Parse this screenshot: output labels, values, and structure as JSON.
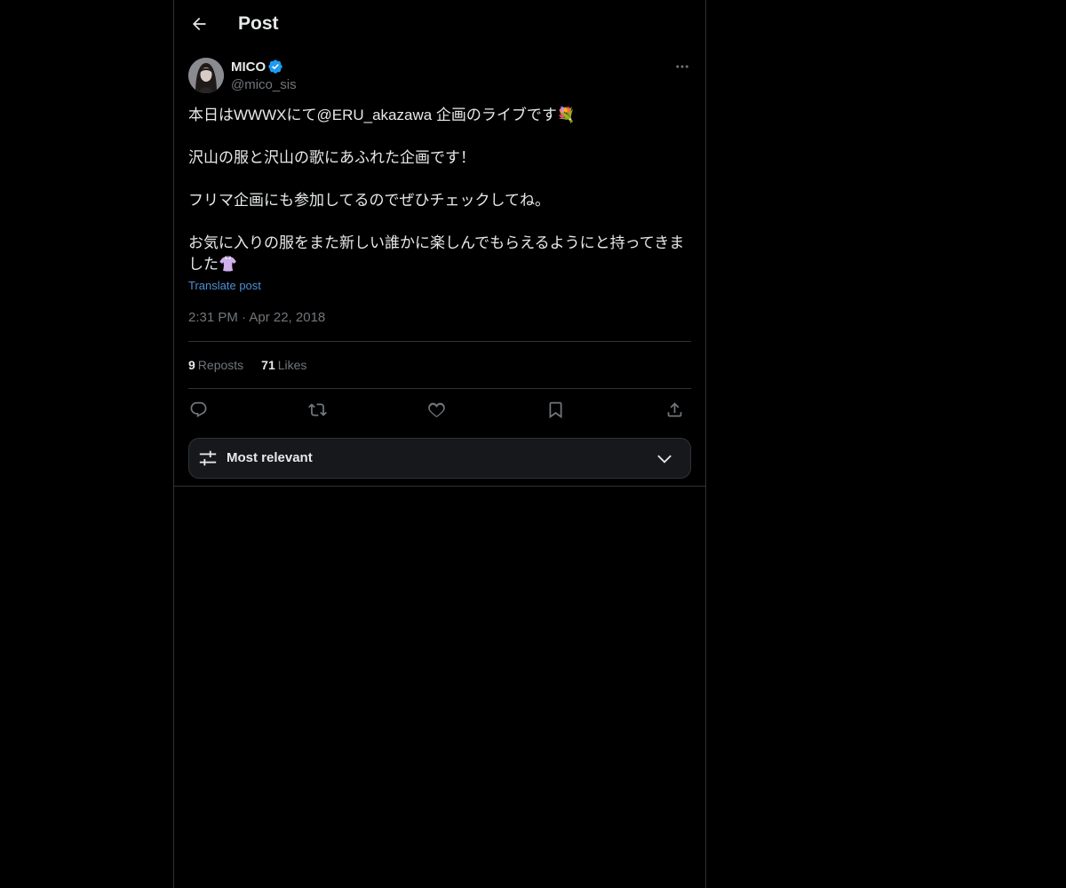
{
  "header": {
    "title": "Post"
  },
  "post": {
    "author_name": "MICO",
    "author_handle": "@mico_sis",
    "text_lines": [
      "本日はWWWXにて@ERU_akazawa 企画のライブです💐",
      "",
      "沢山の服と沢山の歌にあふれた企画です！",
      "",
      "フリマ企画にも参加してるのでぜひチェックしてね。",
      "",
      "お気に入りの服をまた新しい誰かに楽しんでもらえるようにと持ってきま",
      "した👚"
    ],
    "translate_label": "Translate post",
    "timestamp": "2:31 PM · Apr 22, 2018"
  },
  "stats": {
    "reposts_count": "9",
    "reposts_label": "Reposts",
    "likes_count": "71",
    "likes_label": "Likes"
  },
  "actions": {
    "icons": [
      "reply-icon",
      "repost-icon",
      "like-icon",
      "bookmark-icon",
      "share-icon"
    ]
  },
  "sort": {
    "label": "Most relevant"
  },
  "colors": {
    "background": "#000000",
    "text": "#e7e9ea",
    "secondary_text": "#71767b",
    "link": "#4d8fd6",
    "verified": "#1d9bf0",
    "border": "#2f3336"
  }
}
